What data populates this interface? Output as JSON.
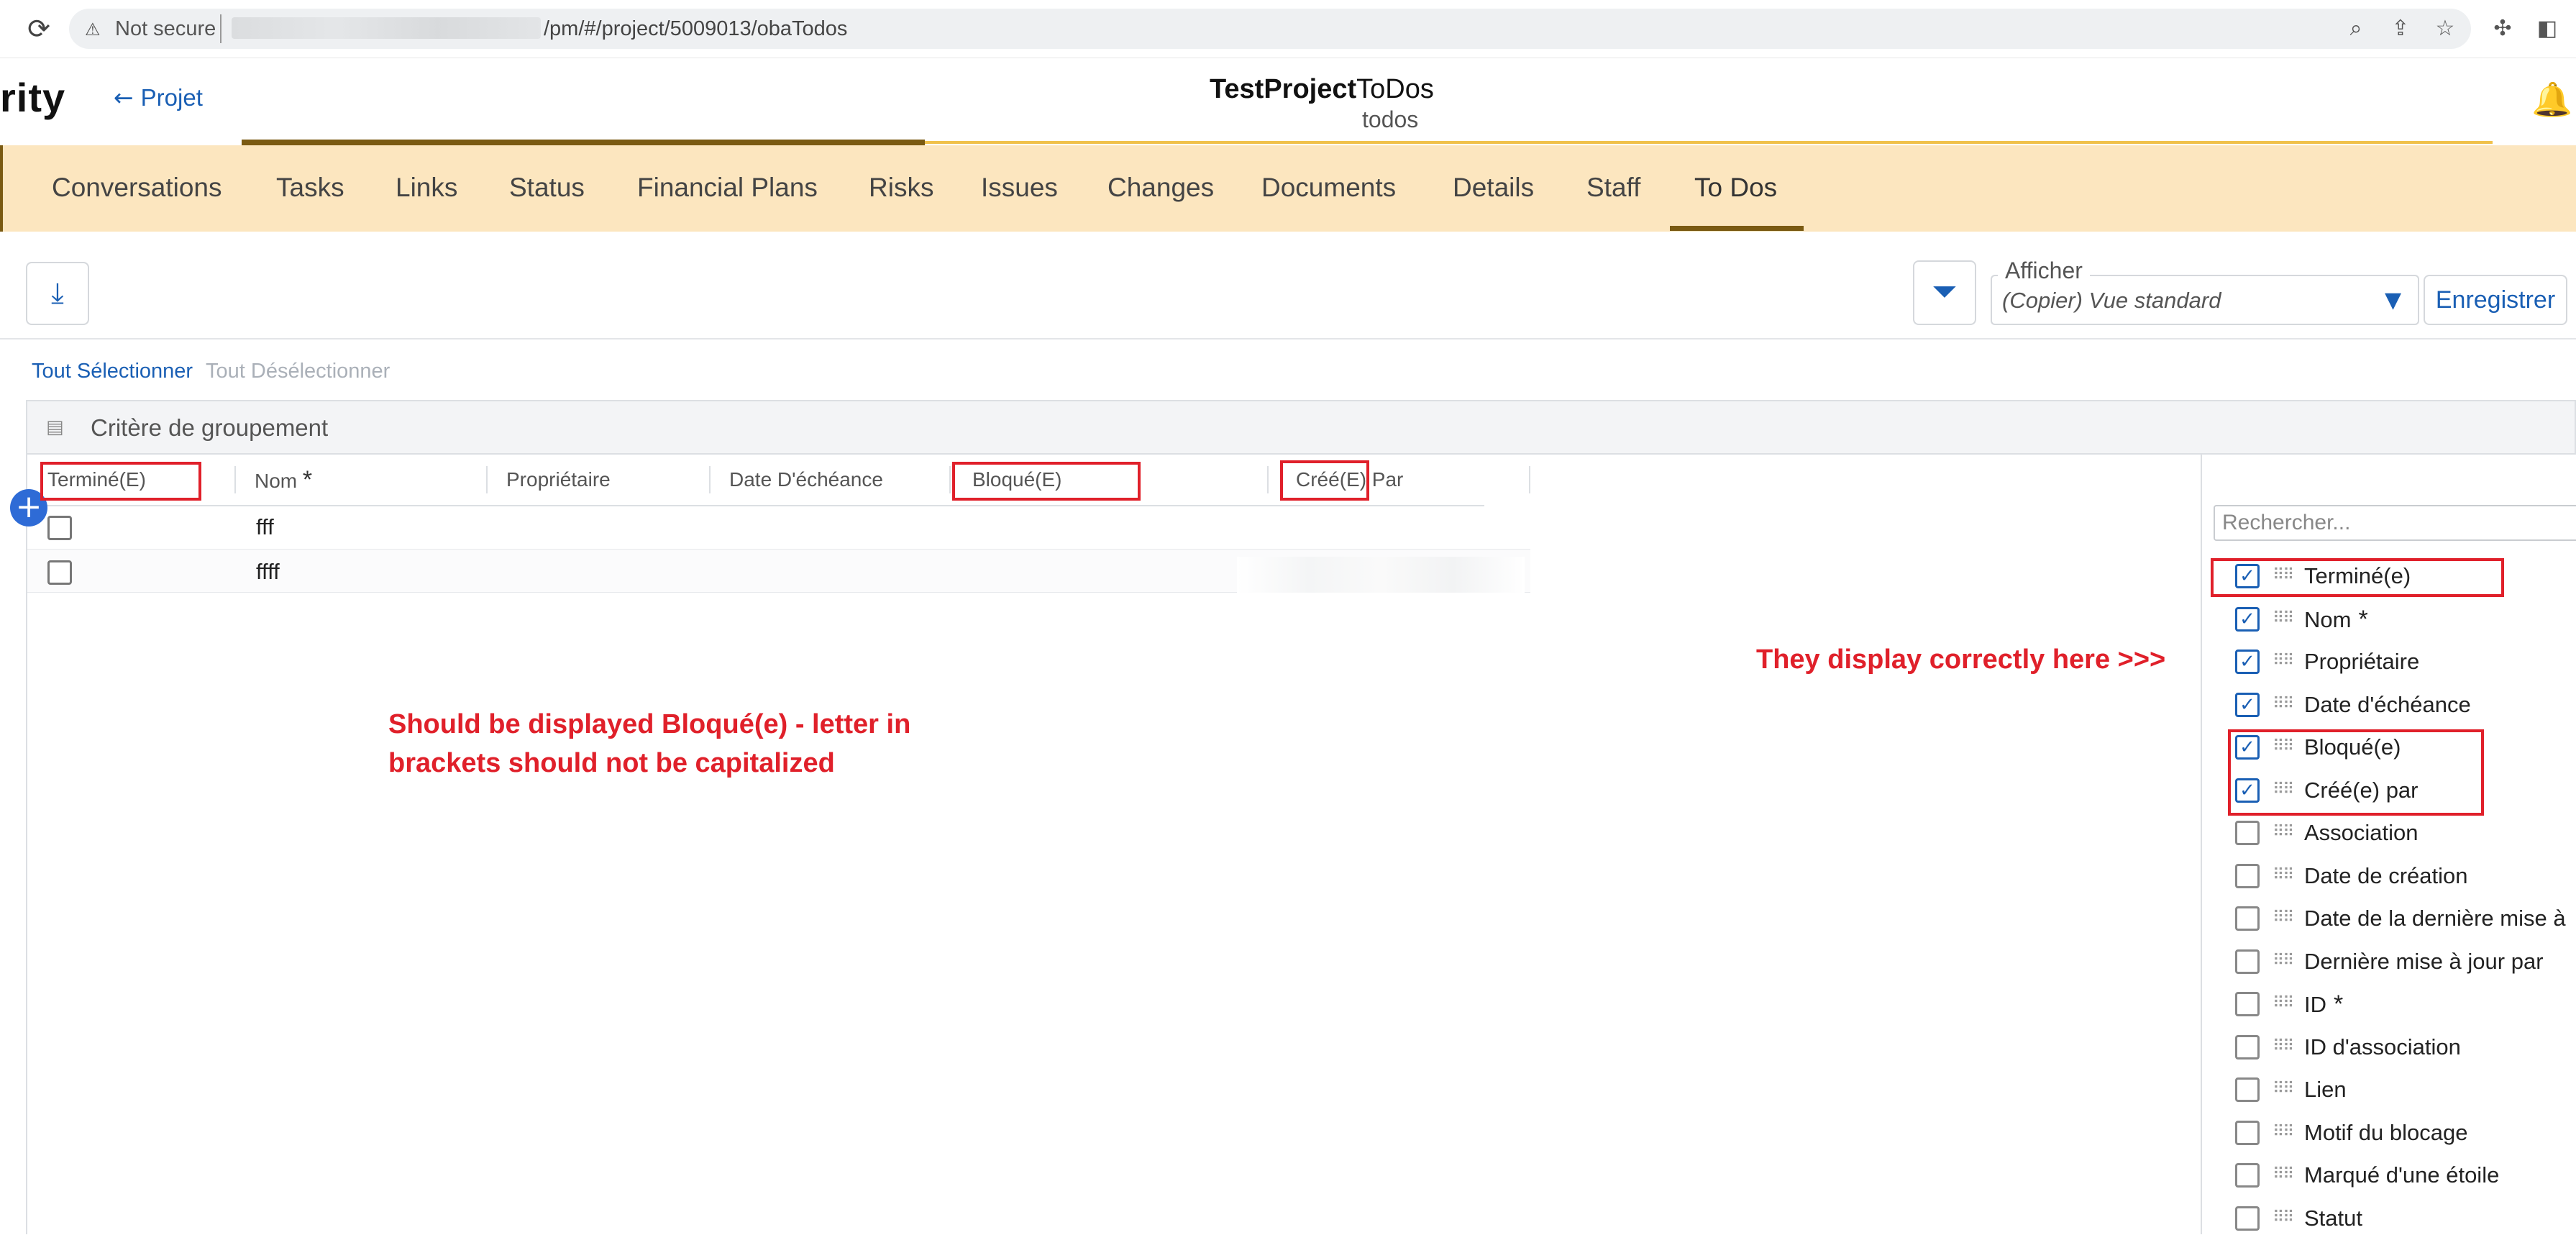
{
  "browser": {
    "not_secure": "Not secure",
    "url": "/pm/#/project/5009013/obaTodos",
    "icons": [
      "reload-icon",
      "warning-icon",
      "zoom-icon",
      "share-icon",
      "star-icon",
      "extensions-icon",
      "sidebar-icon"
    ]
  },
  "header": {
    "app_name": "rity",
    "back_label": "Projet",
    "title_bold": "TestProject",
    "title_rest": "ToDos",
    "subtitle": "todos"
  },
  "tabs": [
    {
      "label": "Conversations"
    },
    {
      "label": "Tasks"
    },
    {
      "label": "Links"
    },
    {
      "label": "Status"
    },
    {
      "label": "Financial Plans"
    },
    {
      "label": "Risks"
    },
    {
      "label": "Issues"
    },
    {
      "label": "Changes"
    },
    {
      "label": "Documents"
    },
    {
      "label": "Details"
    },
    {
      "label": "Staff"
    },
    {
      "label": "To Dos",
      "active": true
    }
  ],
  "toolbar": {
    "view_legend": "Afficher",
    "view_value": "(Copier) Vue standard",
    "save_label": "Enregistrer",
    "select_all": "Tout Sélectionner",
    "deselect_all": "Tout Désélectionner"
  },
  "grid": {
    "group_label": "Critère de groupement",
    "columns": [
      "Terminé(E)",
      "Nom",
      "Propriétaire",
      "Date D'échéance",
      "Bloqué(E)",
      "Créé(E) Par"
    ],
    "required_mark": "*",
    "rows": [
      {
        "done": false,
        "name": "fff"
      },
      {
        "done": false,
        "name": "ffff"
      }
    ]
  },
  "column_panel": {
    "search_placeholder": "Rechercher...",
    "items": [
      {
        "label": "Terminé(e)",
        "checked": true
      },
      {
        "label": "Nom",
        "checked": true,
        "star": true
      },
      {
        "label": "Propriétaire",
        "checked": true
      },
      {
        "label": "Date d'échéance",
        "checked": true
      },
      {
        "label": "Bloqué(e)",
        "checked": true
      },
      {
        "label": "Créé(e) par",
        "checked": true
      },
      {
        "label": "Association",
        "checked": false
      },
      {
        "label": "Date de création",
        "checked": false
      },
      {
        "label": "Date de la dernière mise à",
        "checked": false
      },
      {
        "label": "Dernière mise à jour par",
        "checked": false
      },
      {
        "label": "ID",
        "checked": false,
        "star": true
      },
      {
        "label": "ID d'association",
        "checked": false
      },
      {
        "label": "Lien",
        "checked": false
      },
      {
        "label": "Motif du blocage",
        "checked": false
      },
      {
        "label": "Marqué d'une étoile",
        "checked": false
      },
      {
        "label": "Statut",
        "checked": false
      }
    ]
  },
  "annotations": {
    "left_line1": "Should be displayed Bloqué(e) - letter in",
    "left_line2": "brackets should not be capitalized",
    "right": "They display correctly here >>>"
  },
  "colors": {
    "accent": "#1a5fb4",
    "tab_bar": "#fce6bf",
    "tab_active": "#7a5a12",
    "annotation_red": "#e0202a"
  }
}
